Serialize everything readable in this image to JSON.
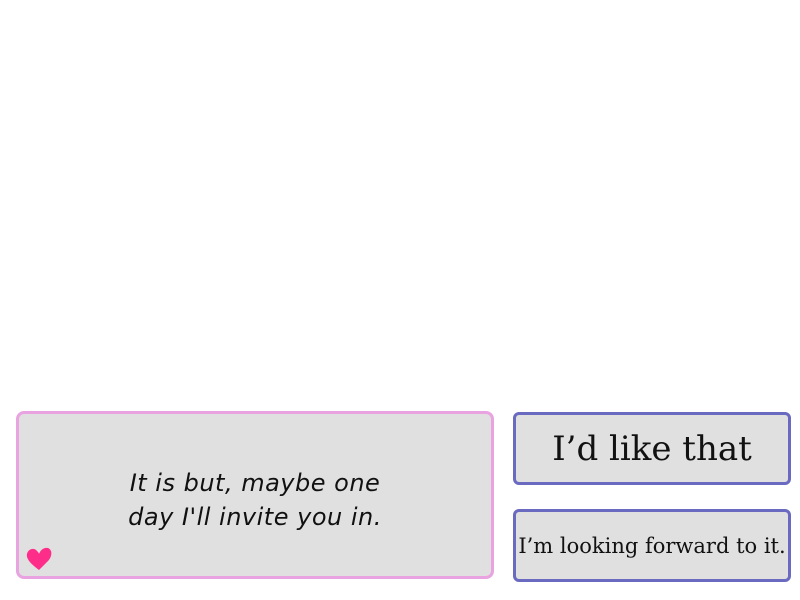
{
  "dialogue": {
    "text": "It is but, maybe one\nday I'll invite you in."
  },
  "icons": {
    "corner": "heart-icon"
  },
  "colors": {
    "dialogue_border": "#e9a3e0",
    "choice_border": "#6a6ac0",
    "box_fill": "#e0e0e0",
    "heart": "#ff2d8a"
  },
  "choices": [
    {
      "label": "I’d like that"
    },
    {
      "label": "I’m looking forward to it."
    }
  ]
}
